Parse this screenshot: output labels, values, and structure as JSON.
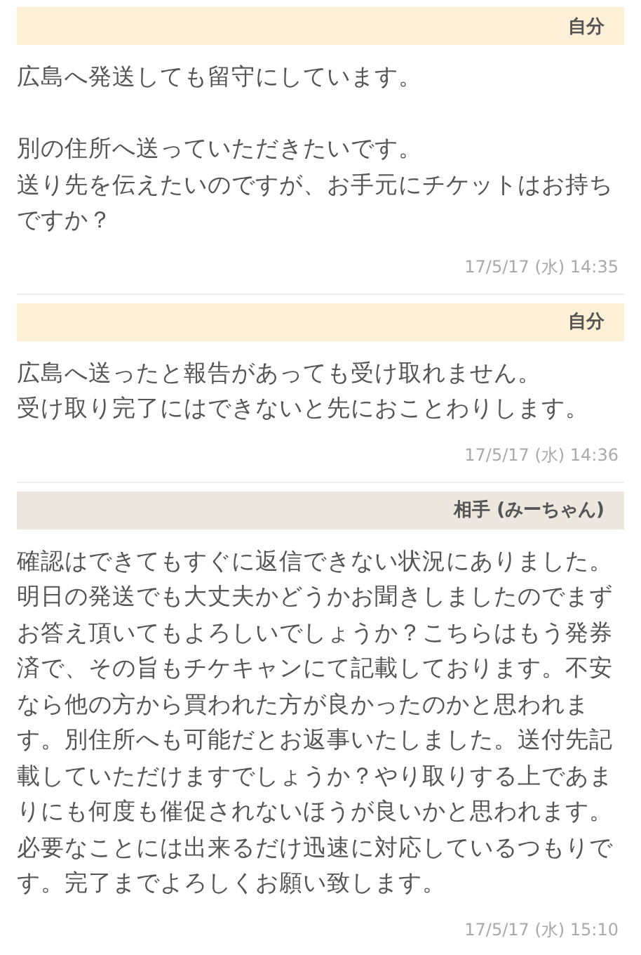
{
  "messages": [
    {
      "sender": "自分",
      "kind": "self",
      "paragraphs": [
        [
          "広島へ発送しても留守にしています。"
        ],
        [
          "別の住所へ送っていただきたいです。",
          "送り先を伝えたいのですが、お手元にチケットはお持ちですか？"
        ]
      ],
      "time": "17/5/17 (水) 14:35"
    },
    {
      "sender": "自分",
      "kind": "self",
      "paragraphs": [
        [
          "広島へ送ったと報告があっても受け取れません。",
          "受け取り完了にはできないと先におことわりします。"
        ]
      ],
      "time": "17/5/17 (水) 14:36"
    },
    {
      "sender": "相手 (みーちゃん)",
      "kind": "other",
      "paragraphs": [
        [
          "確認はできてもすぐに返信できない状況にありました。明日の発送でも大丈夫かどうかお聞きしましたのでまずお答え頂いてもよろしいでしょうか？こちらはもう発券済で、その旨もチケキャンにて記載しております。不安なら他の方から買われた方が良かったのかと思われます。別住所へも可能だとお返事いたしました。送付先記載していただけますでしょうか？やり取りする上であまりにも何度も催促されないほうが良いかと思われます。必要なことには出来るだけ迅速に対応しているつもりです。完了までよろしくお願い致します。"
        ]
      ],
      "time": "17/5/17 (水) 15:10"
    }
  ]
}
